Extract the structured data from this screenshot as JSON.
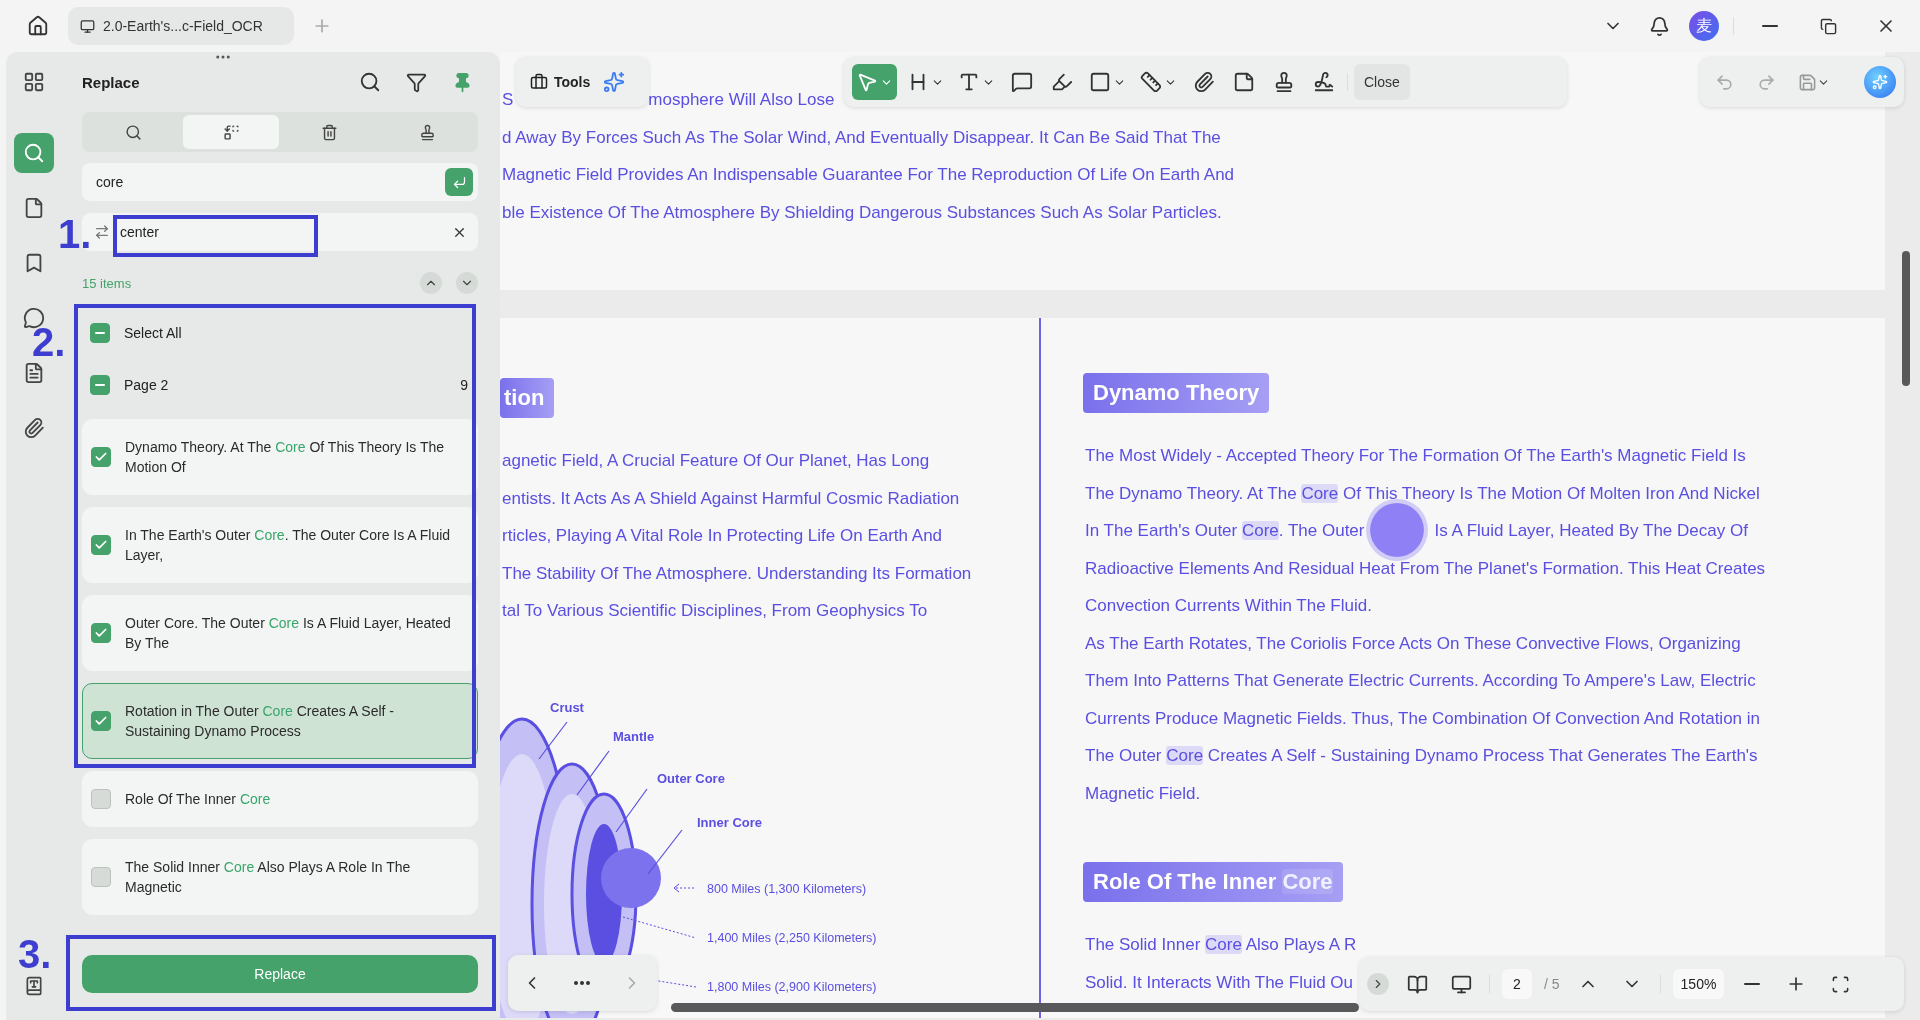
{
  "tab": {
    "title": "2.0-Earth's...c-Field_OCR"
  },
  "avatar": {
    "initial": "麦"
  },
  "panel": {
    "title": "Replace",
    "modes": [
      {
        "kind": "search",
        "selected": false
      },
      {
        "kind": "replace",
        "selected": true
      },
      {
        "kind": "delete",
        "selected": false
      },
      {
        "kind": "redact",
        "selected": false
      }
    ],
    "search": {
      "value": "core"
    },
    "replace": {
      "value": "center"
    },
    "count": "15 items",
    "groups": [
      {
        "label": "Select All",
        "partial": true
      },
      {
        "label": "Page 2",
        "partial": true,
        "count": "9"
      }
    ],
    "results": [
      {
        "checked": true,
        "selected": false,
        "segments": [
          {
            "kind": "text",
            "text": "Dynamo Theory. At The "
          },
          {
            "kind": "match",
            "text": "Core"
          },
          {
            "kind": "text",
            "text": " Of This Theory Is The Motion Of"
          }
        ]
      },
      {
        "checked": true,
        "selected": false,
        "segments": [
          {
            "kind": "text",
            "text": "In The Earth's Outer "
          },
          {
            "kind": "match",
            "text": "Core"
          },
          {
            "kind": "text",
            "text": ". The Outer Core Is A Fluid Layer,"
          }
        ]
      },
      {
        "checked": true,
        "selected": false,
        "segments": [
          {
            "kind": "text",
            "text": "Outer Core. The Outer "
          },
          {
            "kind": "match",
            "text": "Core"
          },
          {
            "kind": "text",
            "text": " Is A Fluid Layer, Heated By The"
          }
        ]
      },
      {
        "checked": true,
        "selected": true,
        "segments": [
          {
            "kind": "text",
            "text": "Rotation in The Outer "
          },
          {
            "kind": "match",
            "text": "Core"
          },
          {
            "kind": "text",
            "text": " Creates A Self - Sustaining Dynamo Process"
          }
        ]
      },
      {
        "checked": false,
        "selected": false,
        "segments": [
          {
            "kind": "text",
            "text": "Role Of The Inner "
          },
          {
            "kind": "match",
            "text": "Core"
          }
        ]
      },
      {
        "checked": false,
        "selected": false,
        "segments": [
          {
            "kind": "text",
            "text": "The Solid Inner "
          },
          {
            "kind": "match",
            "text": "Core"
          },
          {
            "kind": "text",
            "text": " Also Plays A Role In The Magnetic"
          }
        ]
      }
    ],
    "button": "Replace"
  },
  "toolbar": {
    "tools_label": "Tools",
    "close": "Close",
    "tools": [
      {
        "kind": "select",
        "selected": true,
        "has_menu": true
      },
      {
        "kind": "textbox",
        "selected": false,
        "has_menu": true
      },
      {
        "kind": "text",
        "selected": false,
        "has_menu": true
      },
      {
        "kind": "comment",
        "selected": false,
        "has_menu": false
      },
      {
        "kind": "highlighter",
        "selected": false,
        "has_menu": false
      },
      {
        "kind": "shape",
        "selected": false,
        "has_menu": true
      },
      {
        "kind": "measure",
        "selected": false,
        "has_menu": true
      },
      {
        "kind": "attach",
        "selected": false,
        "has_menu": false
      },
      {
        "kind": "sticker",
        "selected": false,
        "has_menu": false
      },
      {
        "kind": "stamp",
        "selected": false,
        "has_menu": false
      },
      {
        "kind": "signature",
        "selected": false,
        "has_menu": false
      }
    ]
  },
  "annotations": [
    {
      "label": "1."
    },
    {
      "label": "2."
    },
    {
      "label": "3."
    }
  ],
  "pointer_shown": true,
  "page1": {
    "lines": [
      [
        {
          "kind": "text",
          "text": "S"
        },
        {
          "kind": "gap"
        },
        {
          "kind": "text",
          "text": "mosphere Will Also Lose"
        }
      ],
      [
        {
          "kind": "text",
          "text": "d Away By Forces Such As The Solar Wind, And Eventually Disappear. It Can Be Said That The"
        }
      ],
      [
        {
          "kind": "text",
          "text": "Magnetic Field Provides An Indispensable Guarantee For The Reproduction Of Life On Earth And"
        }
      ],
      [
        {
          "kind": "text",
          "text": "ble Existence Of The Atmosphere By Shielding Dangerous Substances Such As Solar Particles."
        }
      ]
    ]
  },
  "page2": {
    "left": {
      "heading": "tion",
      "lines": [
        [
          {
            "kind": "text",
            "text": "agnetic Field, A Crucial Feature Of Our Planet, Has Long"
          }
        ],
        [
          {
            "kind": "text",
            "text": "entists. It Acts As A Shield Against Harmful Cosmic Radiation"
          }
        ],
        [
          {
            "kind": "text",
            "text": "rticles, Playing A Vital Role In Protecting Life On Earth And"
          }
        ],
        [
          {
            "kind": "text",
            "text": "The Stability Of The Atmosphere. Understanding Its Formation"
          }
        ],
        [
          {
            "kind": "text",
            "text": "tal To Various Scientific Disciplines, From Geophysics To"
          }
        ]
      ]
    },
    "diagram": {
      "layers": [
        {
          "label": "Crust"
        },
        {
          "label": "Mantle"
        },
        {
          "label": "Outer Core"
        },
        {
          "label": "Inner Core"
        }
      ],
      "distances": [
        {
          "label": "800 Miles (1,300 Kilometers)"
        },
        {
          "label": "1,400 Miles (2,250 Kilometers)"
        },
        {
          "label": "1,800 Miles (2,900 Kilometers)"
        }
      ]
    },
    "right": [
      {
        "heading": [
          {
            "kind": "text",
            "text": "Dynamo Theory"
          }
        ],
        "lines": [
          [
            {
              "kind": "text",
              "text": "The Most Widely - Accepted Theory For The Formation Of The Earth's Magnetic Field Is"
            }
          ],
          [
            {
              "kind": "text",
              "text": "The Dynamo Theory. At The "
            },
            {
              "kind": "match",
              "text": "Core"
            },
            {
              "kind": "text",
              "text": " Of This Theory Is The Motion Of Molten Iron And Nickel"
            }
          ],
          [
            {
              "kind": "text",
              "text": "In The Earth's Outer "
            },
            {
              "kind": "match",
              "text": "Core"
            },
            {
              "kind": "text",
              "text": ". The Outer"
            },
            {
              "kind": "gap"
            },
            {
              "kind": "text",
              "text": "Is A Fluid Layer, Heated By The Decay Of"
            }
          ],
          [
            {
              "kind": "text",
              "text": "Radioactive Elements And Residual Heat From The Planet's Formation. This Heat Creates"
            }
          ],
          [
            {
              "kind": "text",
              "text": "Convection Currents Within The Fluid."
            }
          ],
          [
            {
              "kind": "text",
              "text": "As The Earth Rotates, The Coriolis Force Acts On These Convective Flows, Organizing"
            }
          ],
          [
            {
              "kind": "text",
              "text": "Them Into Patterns That Generate Electric Currents. According To Ampere's Law, Electric"
            }
          ],
          [
            {
              "kind": "text",
              "text": "Currents Produce Magnetic Fields. Thus, The Combination Of Convection And Rotation in"
            }
          ],
          [
            {
              "kind": "text",
              "text": "The Outer "
            },
            {
              "kind": "match",
              "text": "Core"
            },
            {
              "kind": "text",
              "text": " Creates A Self - Sustaining Dynamo Process That Generates The Earth's"
            }
          ],
          [
            {
              "kind": "text",
              "text": "Magnetic Field."
            }
          ]
        ]
      },
      {
        "heading": [
          {
            "kind": "text",
            "text": "Role Of The Inner "
          },
          {
            "kind": "match",
            "text": "Core"
          }
        ],
        "lines": [
          [
            {
              "kind": "text",
              "text": "The Solid Inner "
            },
            {
              "kind": "match",
              "text": "Core"
            },
            {
              "kind": "text",
              "text": " Also Plays A R"
            }
          ],
          [
            {
              "kind": "text",
              "text": "Solid. It Interacts With The Fluid Ou"
            }
          ]
        ]
      }
    ]
  },
  "pager": {
    "page": "2",
    "total": "/ 5",
    "zoom": "150%"
  }
}
